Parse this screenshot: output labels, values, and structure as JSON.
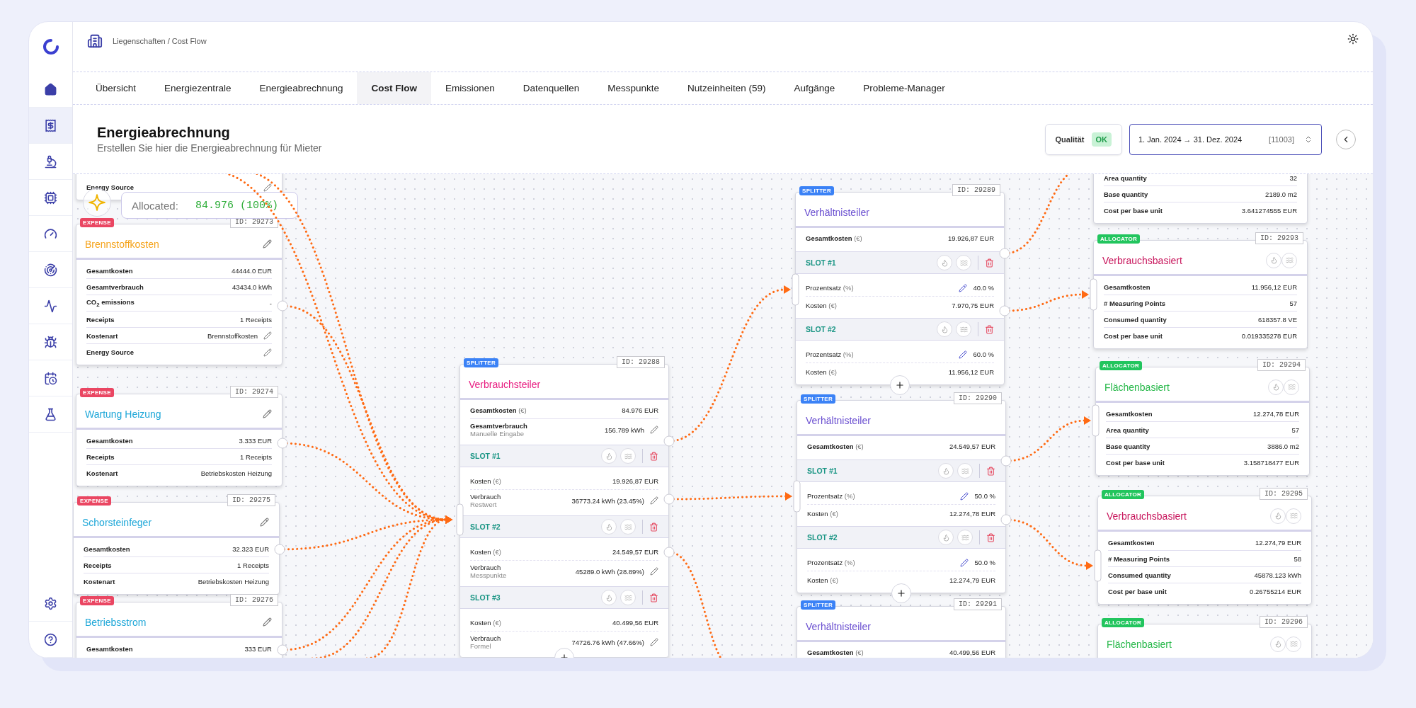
{
  "sidebar": {
    "items": [
      {
        "selected": false
      },
      {
        "selected": true
      },
      {
        "selected": false
      },
      {
        "selected": false
      },
      {
        "selected": false
      },
      {
        "selected": false
      },
      {
        "selected": false
      },
      {
        "selected": false
      },
      {
        "selected": false
      },
      {
        "selected": false
      }
    ],
    "bottom_items": [
      {
        "selected": false
      },
      {
        "selected": false
      }
    ]
  },
  "breadcrumb": "Liegenschaften / Cost Flow",
  "tabs": [
    {
      "label": "Übersicht",
      "selected": false
    },
    {
      "label": "Energiezentrale",
      "selected": false
    },
    {
      "label": "Energieabrechnung",
      "selected": false
    },
    {
      "label": "Cost Flow",
      "selected": true
    },
    {
      "label": "Emissionen",
      "selected": false
    },
    {
      "label": "Datenquellen",
      "selected": false
    },
    {
      "label": "Messpunkte",
      "selected": false
    },
    {
      "label": "Nutzeinheiten (59)",
      "selected": false
    },
    {
      "label": "Aufgänge",
      "selected": false
    },
    {
      "label": "Probleme-Manager",
      "selected": false
    }
  ],
  "page": {
    "title": "Energieabrechnung",
    "subtitle": "Erstellen Sie hier die Energieabrechnung für Mieter",
    "quality": {
      "label": "Qualität",
      "status": "OK"
    },
    "date_range": {
      "value": "1. Jan. 2024 → 31. Dez. 2024",
      "code": "[11003]"
    }
  },
  "canvas": {
    "allocated": {
      "label": "Allocated:",
      "value": "84.976 (100%)"
    },
    "nodes": [
      {
        "kind": "expense",
        "rows": [
          {
            "label": "Energy Source",
            "editable": true
          }
        ]
      },
      {
        "kind": "expense",
        "badge": "EXPENSE",
        "id_label": "ID: 29273",
        "title": "Brennstoffkosten",
        "color": "#f5a31a",
        "rows": [
          {
            "label": "Gesamtkosten",
            "value": "44444.0 EUR"
          },
          {
            "label": "Gesamtverbrauch",
            "value": "43434.0 kWh"
          },
          {
            "label": "CO$_{2}$ emissions",
            "value": "-"
          },
          {
            "label": "Receipts",
            "value": "1 Receipts"
          },
          {
            "label": "Kostenart",
            "value": "Brennstoffkosten",
            "editable": true
          },
          {
            "label": "Energy Source",
            "editable": true
          }
        ]
      },
      {
        "kind": "expense",
        "badge": "EXPENSE",
        "id_label": "ID: 29274",
        "title": "Wartung Heizung",
        "color": "#1ea7d8",
        "rows": [
          {
            "label": "Gesamtkosten",
            "value": "3.333 EUR"
          },
          {
            "label": "Receipts",
            "value": "1 Receipts"
          },
          {
            "label": "Kostenart",
            "value": "Betriebskosten Heizung"
          }
        ]
      },
      {
        "kind": "expense",
        "badge": "EXPENSE",
        "id_label": "ID: 29275",
        "title": "Schorsteinfeger",
        "color": "#1ea7d8",
        "rows": [
          {
            "label": "Gesamtkosten",
            "value": "32.323 EUR"
          },
          {
            "label": "Receipts",
            "value": "1 Receipts"
          },
          {
            "label": "Kostenart",
            "value": "Betriebskosten Heizung"
          }
        ]
      },
      {
        "kind": "expense",
        "badge": "EXPENSE",
        "id_label": "ID: 29276",
        "title": "Betriebsstrom",
        "color": "#1ea7d8",
        "rows": [
          {
            "label": "Gesamtkosten",
            "value": "333 EUR"
          }
        ]
      },
      {
        "kind": "splitter",
        "badge": "SPLITTER",
        "id_label": "ID: 29288",
        "title": "Verbrauchsteiler",
        "color": "#e8197f",
        "rows": [
          {
            "label": "Gesamtkosten",
            "unit": "(€)",
            "value": "84.976 EUR"
          },
          {
            "label": "Gesamtverbrauch",
            "sublabel": "Manuelle Eingabe",
            "value": "156.789 kWh",
            "editable": true
          }
        ],
        "slots": [
          {
            "name": "SLOT #1",
            "rows": [
              {
                "label": "Kosten",
                "unit": "(€)",
                "value": "19.926,87 EUR"
              },
              {
                "label": "Verbrauch",
                "sublabel": "Restwert",
                "value": "36773.24 kWh (23.45%)",
                "editable": true
              }
            ]
          },
          {
            "name": "SLOT #2",
            "rows": [
              {
                "label": "Kosten",
                "unit": "(€)",
                "value": "24.549,57 EUR"
              },
              {
                "label": "Verbrauch",
                "sublabel": "Messpunkte",
                "value": "45289.0 kWh (28.89%)",
                "editable": true
              }
            ]
          },
          {
            "name": "SLOT #3",
            "rows": [
              {
                "label": "Kosten",
                "unit": "(€)",
                "value": "40.499,56 EUR"
              },
              {
                "label": "Verbrauch",
                "sublabel": "Formel",
                "value": "74726.76 kWh (47.66%)",
                "editable": true
              }
            ]
          }
        ]
      },
      {
        "kind": "splitter",
        "badge": "SPLITTER",
        "id_label": "ID: 29289",
        "title": "Verhältnisteiler",
        "color": "#6a4fd0",
        "rows": [
          {
            "label": "Gesamtkosten",
            "unit": "(€)",
            "value": "19.926,87 EUR"
          }
        ],
        "slots": [
          {
            "name": "SLOT #1",
            "rows": [
              {
                "kind": "percent",
                "label": "Prozentsatz",
                "unit": "(%)",
                "value": "40.0 %",
                "editable": true
              },
              {
                "kind": "amount",
                "label": "Kosten",
                "unit": "(€)",
                "value": "7.970,75 EUR"
              }
            ]
          },
          {
            "name": "SLOT #2",
            "rows": [
              {
                "kind": "percent",
                "label": "Prozentsatz",
                "unit": "(%)",
                "value": "60.0 %",
                "editable": true
              },
              {
                "kind": "amount",
                "label": "Kosten",
                "unit": "(€)",
                "value": "11.956,12 EUR"
              }
            ]
          }
        ]
      },
      {
        "kind": "splitter",
        "badge": "SPLITTER",
        "id_label": "ID: 29290",
        "title": "Verhältnisteiler",
        "color": "#6a4fd0",
        "rows": [
          {
            "label": "Gesamtkosten",
            "unit": "(€)",
            "value": "24.549,57 EUR"
          }
        ],
        "slots": [
          {
            "name": "SLOT #1",
            "rows": [
              {
                "kind": "percent",
                "label": "Prozentsatz",
                "unit": "(%)",
                "value": "50.0 %",
                "editable": true
              },
              {
                "kind": "amount",
                "label": "Kosten",
                "unit": "(€)",
                "value": "12.274,78 EUR"
              }
            ]
          },
          {
            "name": "SLOT #2",
            "rows": [
              {
                "kind": "percent",
                "label": "Prozentsatz",
                "unit": "(%)",
                "value": "50.0 %",
                "editable": true
              },
              {
                "kind": "amount",
                "label": "Kosten",
                "unit": "(€)",
                "value": "12.274,79 EUR"
              }
            ]
          }
        ]
      },
      {
        "kind": "splitter",
        "badge": "SPLITTER",
        "id_label": "ID: 29291",
        "title": "Verhältnisteiler",
        "color": "#6a4fd0",
        "rows": [
          {
            "label": "Gesamtkosten",
            "unit": "(€)",
            "value": "40.499,56 EUR"
          }
        ]
      },
      {
        "kind": "allocator",
        "rows": [
          {
            "label": "Area quantity",
            "value": "32"
          },
          {
            "label": "Base quantity",
            "value": "2189.0 m2"
          },
          {
            "label": "Cost per base unit",
            "value": "3.641274555 EUR"
          }
        ]
      },
      {
        "kind": "allocator",
        "badge": "ALLOCATOR",
        "id_label": "ID: 29293",
        "title": "Verbrauchsbasiert",
        "color": "#c8175d",
        "rows": [
          {
            "label": "Gesamtkosten",
            "value": "11.956,12 EUR"
          },
          {
            "label": "# Measuring Points",
            "value": "57"
          },
          {
            "label": "Consumed quantity",
            "value": "618357.8 VE"
          },
          {
            "label": "Cost per base unit",
            "value": "0.019335278 EUR"
          }
        ]
      },
      {
        "kind": "allocator",
        "badge": "ALLOCATOR",
        "id_label": "ID: 29294",
        "title": "Flächenbasiert",
        "color": "#27b84a",
        "rows": [
          {
            "label": "Gesamtkosten",
            "value": "12.274,78 EUR"
          },
          {
            "label": "Area quantity",
            "value": "57"
          },
          {
            "label": "Base quantity",
            "value": "3886.0 m2"
          },
          {
            "label": "Cost per base unit",
            "value": "3.158718477 EUR"
          }
        ]
      },
      {
        "kind": "allocator",
        "badge": "ALLOCATOR",
        "id_label": "ID: 29295",
        "title": "Verbrauchsbasiert",
        "color": "#c8175d",
        "rows": [
          {
            "label": "Gesamtkosten",
            "value": "12.274,79 EUR"
          },
          {
            "label": "# Measuring Points",
            "value": "58"
          },
          {
            "label": "Consumed quantity",
            "value": "45878.123 kWh"
          },
          {
            "label": "Cost per base unit",
            "value": "0.26755214 EUR"
          }
        ]
      },
      {
        "kind": "allocator",
        "badge": "ALLOCATOR",
        "id_label": "ID: 29296",
        "title": "Flächenbasiert",
        "color": "#27b84a"
      }
    ]
  }
}
